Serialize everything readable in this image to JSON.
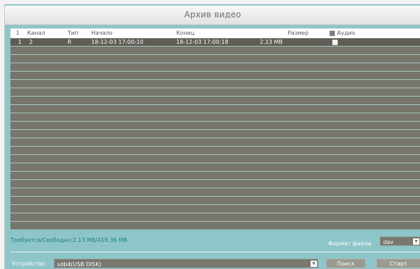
{
  "window": {
    "title": "Архив видео"
  },
  "table": {
    "headers": {
      "index": "1",
      "channel": "Канал",
      "type": "Тип",
      "start": "Начало",
      "end": "Конец",
      "size": "Размер",
      "audio": "Аудио"
    },
    "rows": [
      {
        "index": "1",
        "channel": "2",
        "type": "R",
        "start": "18-12-03 17:00:10",
        "end": "18-12-03 17:00:18",
        "size": "2.13 MB",
        "audio_checked": false
      }
    ],
    "empty_rows": 21
  },
  "footer": {
    "space_info": "Требуется/Свободно:2.13 MB/419.36 MB",
    "format_label": "Формат файла",
    "format_value": "dav",
    "device_label": "Устройство",
    "device_value": "sdb4(USB DISK)",
    "search_button": "Поиск",
    "start_button": "Старт"
  },
  "colors": {
    "window_bg": "#8ec5c8",
    "table_bg": "#76766c",
    "info_text": "#1f7f86"
  }
}
